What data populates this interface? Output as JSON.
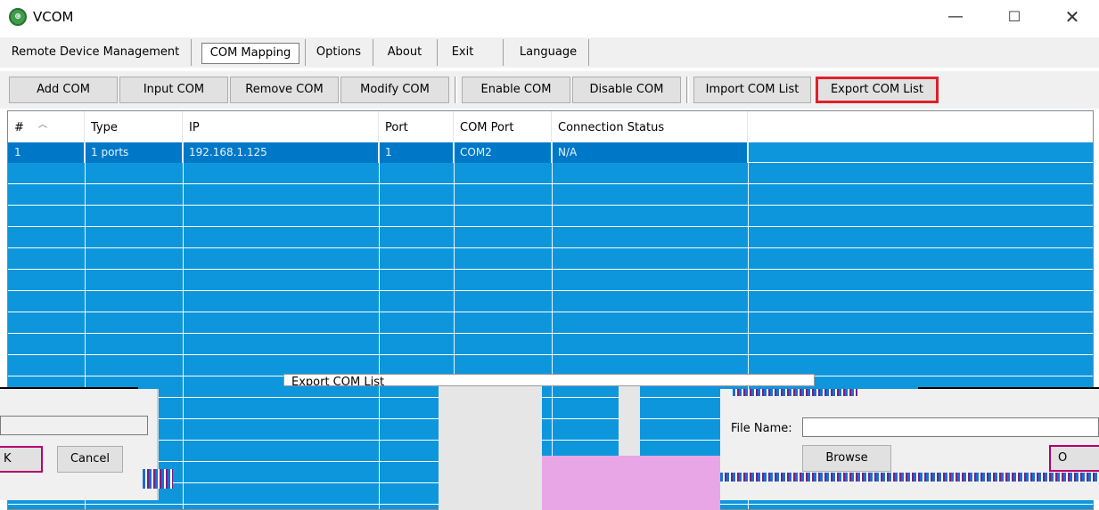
{
  "window": {
    "title": "VCOM",
    "icon": "app-logo-icon",
    "controls": {
      "minimize": "—",
      "maximize": "☐",
      "close": "✕"
    }
  },
  "menu": {
    "items": [
      {
        "label": "Remote Device Management"
      },
      {
        "label": "COM Mapping",
        "active": true
      },
      {
        "label": "Options"
      },
      {
        "label": "About"
      },
      {
        "label": "Exit"
      },
      {
        "label": "Language"
      }
    ]
  },
  "toolbar": {
    "buttons": [
      {
        "label": "Add COM"
      },
      {
        "label": "Input COM"
      },
      {
        "label": "Remove COM"
      },
      {
        "label": "Modify COM"
      },
      {
        "label": "Enable COM"
      },
      {
        "label": "Disable COM"
      },
      {
        "label": "Import COM List"
      },
      {
        "label": "Export COM List",
        "highlighted": true
      }
    ]
  },
  "table": {
    "columns": [
      "#",
      "Type",
      "IP",
      "Port",
      "COM Port",
      "Connection Status"
    ],
    "rows": [
      [
        "1",
        "1 ports",
        "192.168.1.125",
        "1",
        "COM2",
        "N/A"
      ]
    ],
    "selected_row": 0
  },
  "dialog_fragments": {
    "left": {
      "ok_label": "K",
      "cancel_label": "Cancel"
    },
    "middle": {
      "title": "Export COM List"
    },
    "right": {
      "file_name_label": "File Name:",
      "file_name_value": "",
      "browse_label": "Browse",
      "ok_label": "O"
    }
  },
  "colors": {
    "list_bg": "#0e96dc",
    "selected_row": "#0078c8",
    "highlight_border": "#e0202a"
  }
}
